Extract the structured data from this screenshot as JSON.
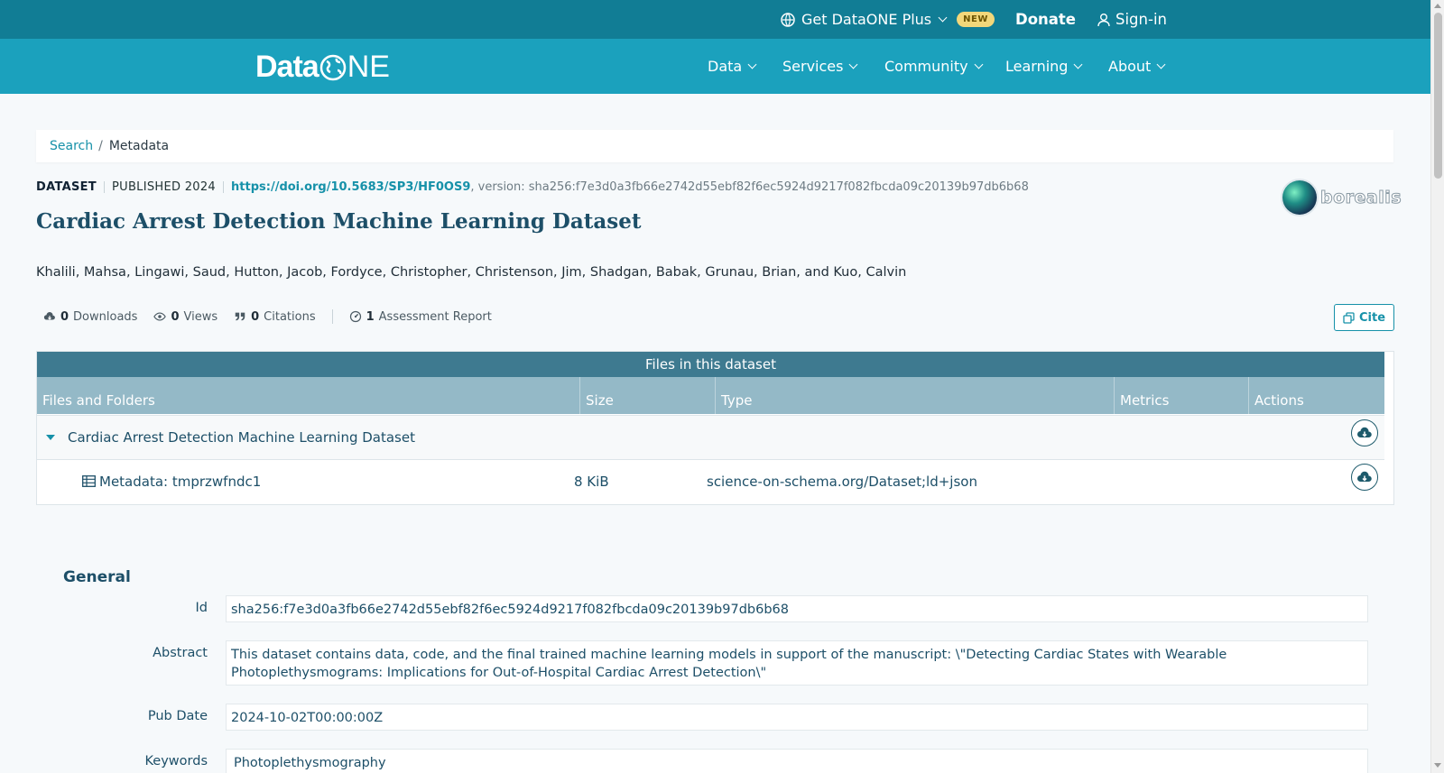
{
  "topbar": {
    "plus_label": "Get DataONE Plus",
    "new_badge": "NEW",
    "donate_label": "Donate",
    "signin_label": "Sign-in"
  },
  "logo": {
    "text_a": "Data",
    "text_b": "NE"
  },
  "nav": {
    "items": [
      {
        "label": "Data"
      },
      {
        "label": "Services"
      },
      {
        "label": "Community"
      },
      {
        "label": "Learning"
      },
      {
        "label": "About"
      }
    ]
  },
  "breadcrumb": {
    "search": "Search",
    "separator": "/",
    "current": "Metadata"
  },
  "dataset": {
    "type": "DATASET",
    "published": "PUBLISHED 2024",
    "doi": "https://doi.org/10.5683/SP3/HF0OS9",
    "version": ", version: sha256:f7e3d0a3fb66e2742d55ebf82f6ec5924d9217f082fbcda09c20139b97db6b68",
    "title": "Cardiac Arrest Detection Machine Learning Dataset",
    "authors": "Khalili, Mahsa, Lingawi, Saud, Hutton, Jacob, Fordyce, Christopher, Christenson, Jim, Shadgan, Babak, Grunau, Brian, and Kuo, Calvin",
    "repository_logo_text": "borealis"
  },
  "stats": {
    "downloads_count": "0",
    "downloads_label": "Downloads",
    "views_count": "0",
    "views_label": "Views",
    "citations_count": "0",
    "citations_label": "Citations",
    "assessment_count": "1",
    "assessment_label": "Assessment Report"
  },
  "cite_label": "Cite",
  "files_table": {
    "caption": "Files in this dataset",
    "headers": [
      "Files and Folders",
      "Size",
      "Type",
      "Metrics",
      "Actions"
    ],
    "rows": [
      {
        "name": "Cardiac Arrest Detection Machine Learning Dataset",
        "size": "",
        "type": ""
      },
      {
        "name": "Metadata: tmprzwfndc1",
        "size": "8 KiB",
        "type": "science-on-schema.org/Dataset;ld+json"
      }
    ]
  },
  "general": {
    "heading": "General",
    "fields": [
      {
        "label": "Id",
        "value": "sha256:f7e3d0a3fb66e2742d55ebf82f6ec5924d9217f082fbcda09c20139b97db6b68"
      },
      {
        "label": "Abstract",
        "value": "This dataset contains data, code, and the final trained machine learning models in support of the manuscript: \\\"Detecting Cardiac States with Wearable Photoplethysmograms: Implications for Out-of-Hospital Cardiac Arrest Detection\\\""
      },
      {
        "label": "Pub Date",
        "value": "2024-10-02T00:00:00Z"
      },
      {
        "label": "Keywords",
        "value": "Photoplethysmography"
      }
    ]
  },
  "colors": {
    "topbar": "#117d95",
    "navbar": "#1ba1bd",
    "accent": "#1691a9",
    "title": "#1d4f68",
    "table_caption": "#3e7a90",
    "table_header": "#94b9c7"
  }
}
